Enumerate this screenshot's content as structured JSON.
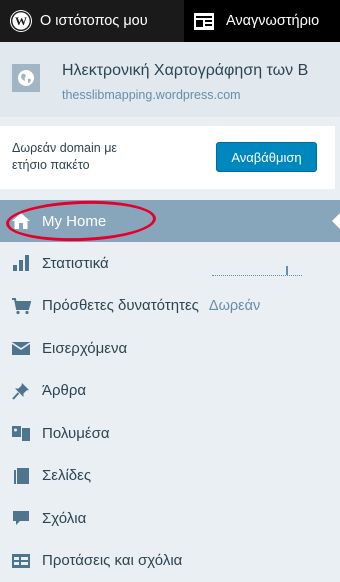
{
  "masterbar": {
    "my_site_label": "Ο ιστότοπος μου",
    "reader_label": "Αναγνωστήριο"
  },
  "site": {
    "title": "Ηλεκτρονική Χαρτογράφηση των Β",
    "domain": "thesslibmapping.wordpress.com"
  },
  "upgrade": {
    "line1": "Δωρεάν domain με",
    "line2": "ετήσιο πακέτο",
    "button": "Αναβάθμιση"
  },
  "menu": {
    "items": [
      {
        "label": "My Home",
        "icon": "home-icon"
      },
      {
        "label": "Στατιστικά",
        "icon": "stats-icon"
      },
      {
        "label": "Πρόσθετες δυνατότητες",
        "icon": "cart-icon",
        "extra": "Δωρεάν"
      },
      {
        "label": "Εισερχόμενα",
        "icon": "mail-icon"
      },
      {
        "label": "Άρθρα",
        "icon": "pin-icon"
      },
      {
        "label": "Πολυμέσα",
        "icon": "media-icon"
      },
      {
        "label": "Σελίδες",
        "icon": "pages-icon"
      },
      {
        "label": "Σχόλια",
        "icon": "comment-icon"
      },
      {
        "label": "Προτάσεις και σχόλια",
        "icon": "feedback-icon"
      }
    ]
  },
  "colors": {
    "masterbar": "#0d0d0d",
    "sidebar_bg": "#e9eff3",
    "active_item": "#87a6bc",
    "upgrade_button": "#0087be",
    "annotation_circle": "#e4002b"
  }
}
